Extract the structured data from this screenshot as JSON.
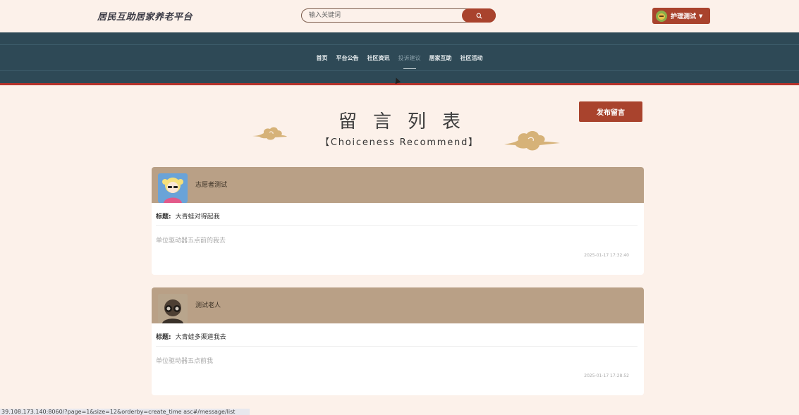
{
  "header": {
    "site_title": "居民互助居家养老平台",
    "search_placeholder": "输入关键词",
    "user_label": "护理测试"
  },
  "nav": {
    "items": [
      {
        "label": "首页",
        "active": false
      },
      {
        "label": "平台公告",
        "active": false
      },
      {
        "label": "社区资讯",
        "active": false
      },
      {
        "label": "投诉建议",
        "active": true
      },
      {
        "label": "居家互助",
        "active": false
      },
      {
        "label": "社区活动",
        "active": false
      }
    ]
  },
  "page": {
    "title_cn": "留言列表",
    "title_en": "【Choiceness Recommend】",
    "publish_label": "发布留言"
  },
  "messages": [
    {
      "author": "志愿者测试",
      "title_label": "标题:",
      "title": "大青蛙对得起我",
      "content": "单位驱动器五点前的我去",
      "time": "2025-01-17 17:32:40"
    },
    {
      "author": "测试老人",
      "title_label": "标题:",
      "title": "大青蛙多渠道我去",
      "content": "单位驱动器五点前我",
      "time": "2025-01-17 17:28:52"
    }
  ],
  "status_url": "39.108.173.140:8060/?page=1&size=12&orderby=create_time asc#/message/list",
  "colors": {
    "accent": "#a9432d",
    "nav_bg": "#2e4956",
    "card_head": "#b9a086",
    "page_bg": "#fcf1ea"
  }
}
